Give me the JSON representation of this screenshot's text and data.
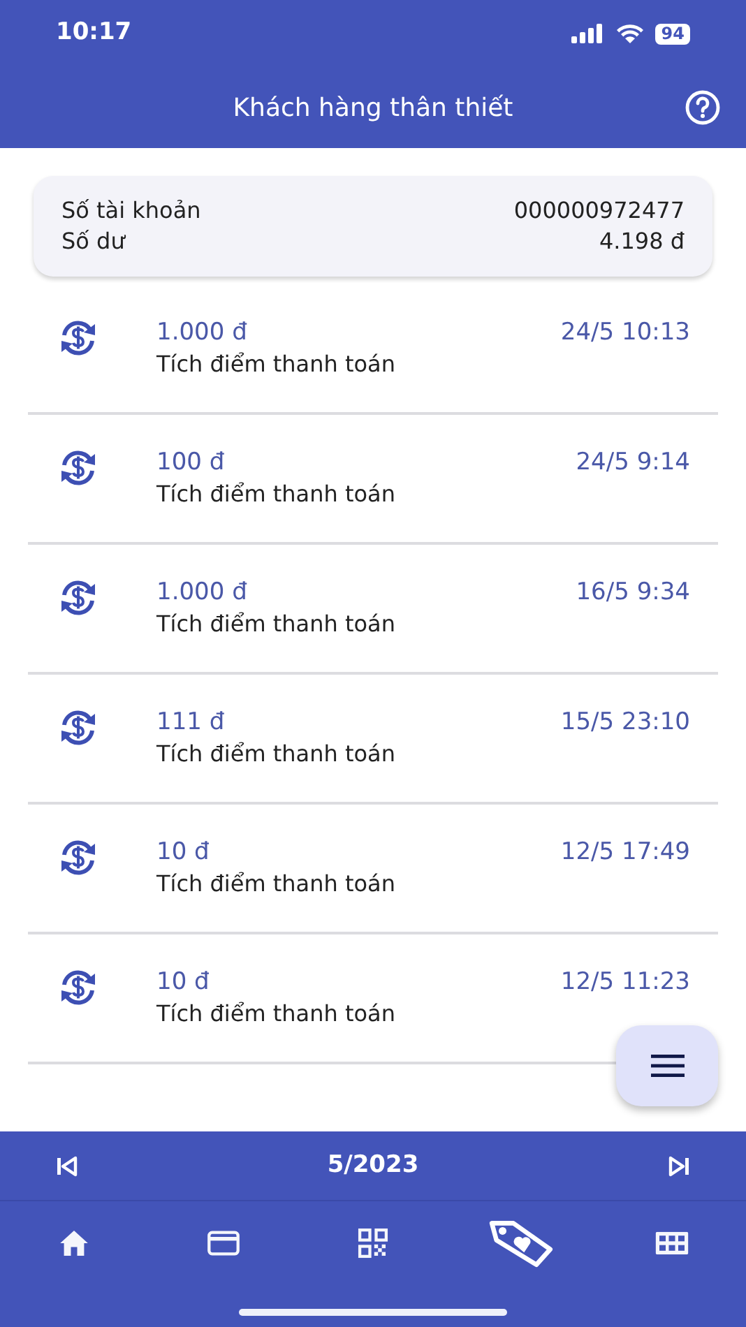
{
  "status_bar": {
    "time": "10:17",
    "battery": "94"
  },
  "header": {
    "title": "Khách hàng thân thiết"
  },
  "account": {
    "number_label": "Số tài khoản",
    "number": "000000972477",
    "balance_label": "Số dư",
    "balance": "4.198 đ"
  },
  "transactions": [
    {
      "amount": "1.000 đ",
      "description": "Tích điểm thanh toán",
      "time": "24/5 10:13"
    },
    {
      "amount": "100 đ",
      "description": "Tích điểm thanh toán",
      "time": "24/5 9:14"
    },
    {
      "amount": "1.000 đ",
      "description": "Tích điểm thanh toán",
      "time": "16/5 9:34"
    },
    {
      "amount": "111 đ",
      "description": "Tích điểm thanh toán",
      "time": "15/5 23:10"
    },
    {
      "amount": "10 đ",
      "description": "Tích điểm thanh toán",
      "time": "12/5 17:49"
    },
    {
      "amount": "10 đ",
      "description": "Tích điểm thanh toán",
      "time": "12/5 11:23"
    }
  ],
  "month_bar": {
    "month": "5/2023"
  },
  "nav": [
    {
      "kind": "home",
      "selected": false
    },
    {
      "kind": "card",
      "selected": false
    },
    {
      "kind": "qr",
      "selected": false
    },
    {
      "kind": "tag",
      "selected": true
    },
    {
      "kind": "grid",
      "selected": false
    }
  ]
}
